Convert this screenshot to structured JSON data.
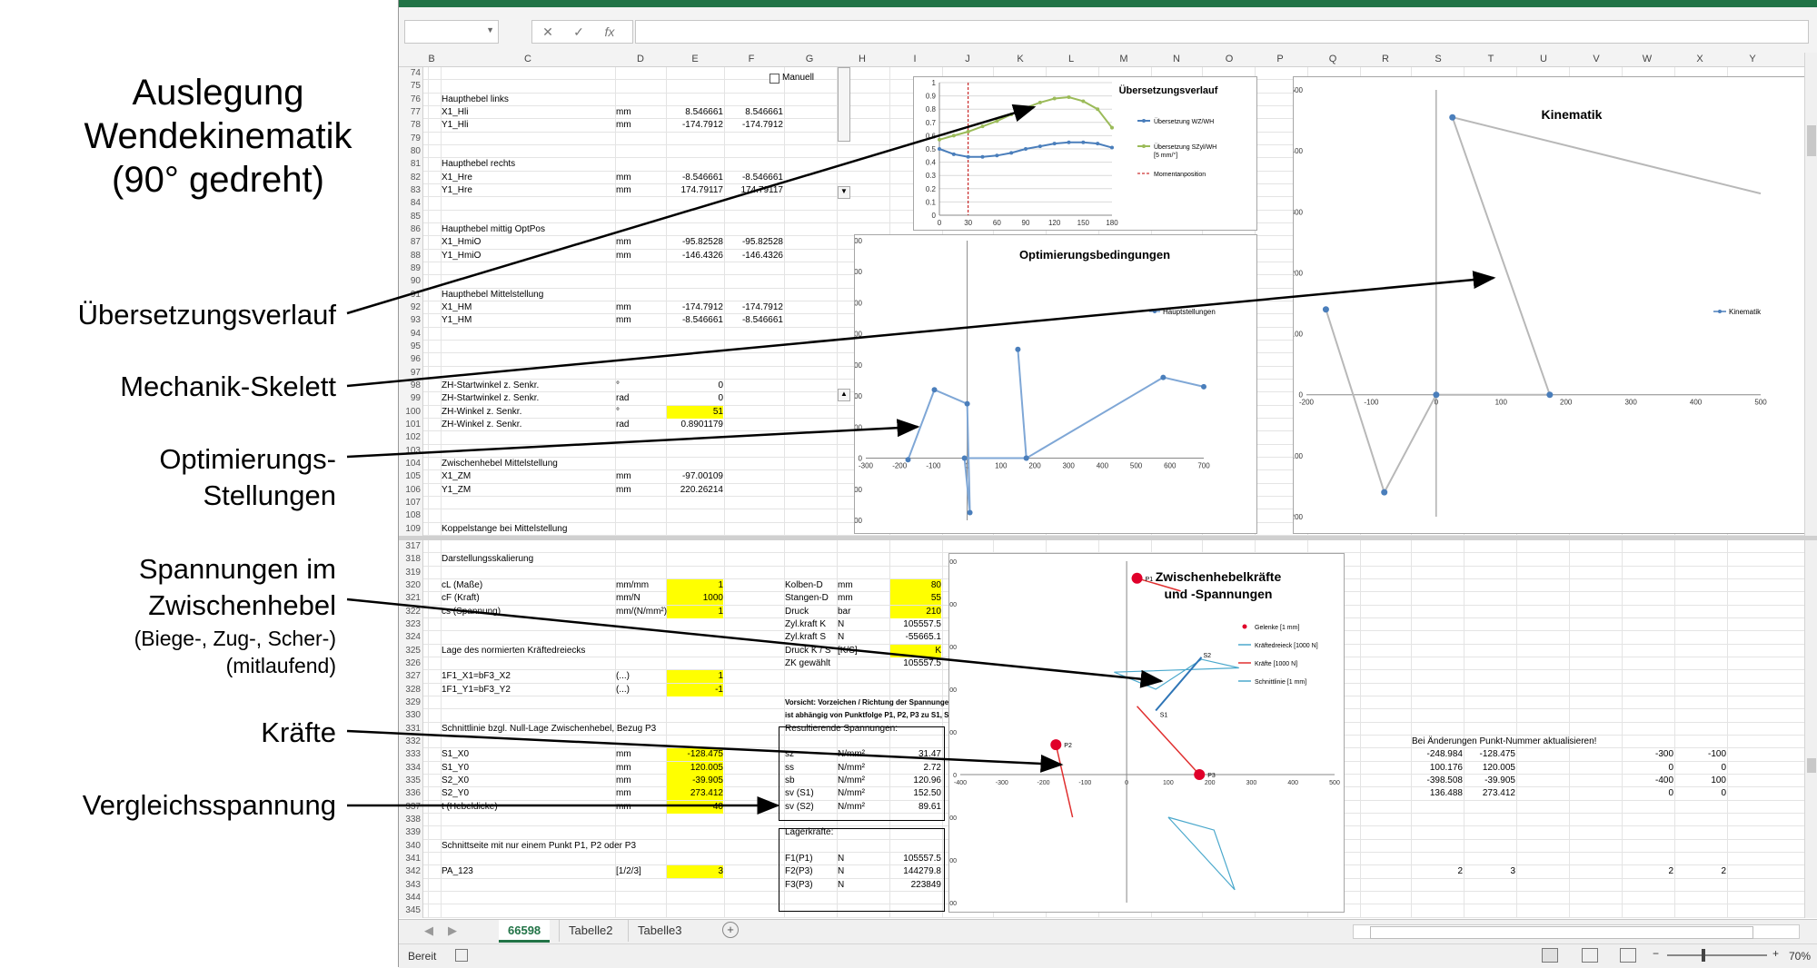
{
  "annotations": {
    "title": [
      "Auslegung",
      "Wendekinematik",
      "(90° gedreht)"
    ],
    "uebersetzungsverlauf": "Übersetzungsverlauf",
    "mechanik": "Mechanik-Skelett",
    "optimierung": [
      "Optimierungs-",
      "Stellungen"
    ],
    "spannungen": [
      "Spannungen im",
      "Zwischenhebel"
    ],
    "spannungen_sub": [
      "(Biege-, Zug-, Scher-)",
      "(mitlaufend)"
    ],
    "kraefte": "Kräfte",
    "vergleich": "Vergleichsspannung"
  },
  "formula_bar": {
    "fx": "fx",
    "cancel": "✕",
    "enter": "✓"
  },
  "columns": [
    "B",
    "C",
    "D",
    "E",
    "F",
    "G",
    "H",
    "I",
    "J",
    "K",
    "L",
    "M",
    "N",
    "O",
    "P",
    "Q",
    "R",
    "S",
    "T",
    "U",
    "V",
    "W",
    "X",
    "Y"
  ],
  "top_rows": [
    "74",
    "75",
    "76",
    "77",
    "78",
    "79",
    "80",
    "81",
    "82",
    "83",
    "84",
    "85",
    "86",
    "87",
    "88",
    "89",
    "90",
    "91",
    "92",
    "93",
    "94",
    "95",
    "96",
    "97",
    "98",
    "99",
    "100",
    "101",
    "102",
    "103",
    "104",
    "105",
    "106",
    "107",
    "108",
    "109"
  ],
  "bottom_rows": [
    "317",
    "318",
    "319",
    "320",
    "321",
    "322",
    "323",
    "324",
    "325",
    "326",
    "327",
    "328",
    "329",
    "330",
    "331",
    "332",
    "333",
    "334",
    "335",
    "336",
    "337",
    "338",
    "339",
    "340",
    "341",
    "342",
    "343",
    "344",
    "345"
  ],
  "top_cells": {
    "r76": {
      "c": "Haupthebel links"
    },
    "r77": {
      "c": "X1_Hli",
      "d": "mm",
      "e": "8.546661",
      "f": "8.546661"
    },
    "r78": {
      "c": "Y1_Hli",
      "d": "mm",
      "e": "-174.7912",
      "f": "-174.7912"
    },
    "r81": {
      "c": "Haupthebel rechts"
    },
    "r82": {
      "c": "X1_Hre",
      "d": "mm",
      "e": "-8.546661",
      "f": "-8.546661"
    },
    "r83": {
      "c": "Y1_Hre",
      "d": "mm",
      "e": "174.79117",
      "f": "174.79117"
    },
    "r86": {
      "c": "Haupthebel mittig OptPos"
    },
    "r87": {
      "c": "X1_HmiO",
      "d": "mm",
      "e": "-95.82528",
      "f": "-95.82528"
    },
    "r88": {
      "c": "Y1_HmiO",
      "d": "mm",
      "e": "-146.4326",
      "f": "-146.4326"
    },
    "r91": {
      "c": "Haupthebel Mittelstellung"
    },
    "r92": {
      "c": "X1_HM",
      "d": "mm",
      "e": "-174.7912",
      "f": "-174.7912"
    },
    "r93": {
      "c": "Y1_HM",
      "d": "mm",
      "e": "-8.546661",
      "f": "-8.546661"
    },
    "r98": {
      "c": "ZH-Startwinkel z. Senkr.",
      "d": "°",
      "e": "0"
    },
    "r99": {
      "c": "ZH-Startwinkel z. Senkr.",
      "d": "rad",
      "e": "0"
    },
    "r100": {
      "c": "ZH-Winkel z. Senkr.",
      "d": "°",
      "e": "51"
    },
    "r101": {
      "c": "ZH-Winkel z. Senkr.",
      "d": "rad",
      "e": "0.8901179"
    },
    "r104": {
      "c": "Zwischenhebel Mittelstellung"
    },
    "r105": {
      "c": "X1_ZM",
      "d": "mm",
      "e": "-97.00109"
    },
    "r106": {
      "c": "Y1_ZM",
      "d": "mm",
      "e": "220.26214"
    },
    "r109": {
      "c": "Koppelstange bei Mittelstellung"
    }
  },
  "bottom_cells": {
    "r318": {
      "c": "Darstellungsskalierung"
    },
    "r320": {
      "c": "cL (Maße)",
      "d": "mm/mm",
      "e": "1",
      "g": "Kolben-D",
      "h": "mm",
      "i": "80"
    },
    "r321": {
      "c": "cF (Kraft)",
      "d": "mm/N",
      "e": "1000",
      "g": "Stangen-D",
      "h": "mm",
      "i": "55"
    },
    "r322": {
      "c": "cs (Spannung)",
      "d": "mm/(N/mm²)",
      "e": "1",
      "g": "Druck",
      "h": "bar",
      "i": "210"
    },
    "r323": {
      "g": "Zyl.kraft K",
      "h": "N",
      "i": "105557.5"
    },
    "r324": {
      "g": "Zyl.kraft S",
      "h": "N",
      "i": "-55665.1"
    },
    "r325": {
      "c": "Lage des normierten Kräftedreiecks",
      "g": "Druck K / S",
      "h": "[K/S]",
      "i": "K"
    },
    "r326": {
      "g": "ZK gewählt",
      "i": "105557.5"
    },
    "r327": {
      "c": "1F1_X1=bF3_X2",
      "d": "(...)",
      "e": "1"
    },
    "r328": {
      "c": "1F1_Y1=bF3_Y2",
      "d": "(...)",
      "e": "-1"
    },
    "r329": {
      "g": "Vorsicht: Vorzeichen / Richtung der Spannungen"
    },
    "r330": {
      "g": "ist abhängig von Punktfolge P1, P2, P3 zu S1, S2!"
    },
    "r331": {
      "c": "Schnittlinie bzgl. Null-Lage Zwischenhebel, Bezug P3",
      "g": "Resultierende Spannungen:"
    },
    "r332": {
      "s": "Bei Änderungen Punkt-Nummer aktualisieren!"
    },
    "r333": {
      "c": "S1_X0",
      "d": "mm",
      "e": "-128.475",
      "g": "sz",
      "h": "N/mm²",
      "i": "31.47",
      "s": "-248.984",
      "t": "-128.475",
      "w": "-300",
      "x": "-100"
    },
    "r334": {
      "c": "S1_Y0",
      "d": "mm",
      "e": "120.005",
      "g": "ss",
      "h": "N/mm²",
      "i": "2.72",
      "s": "100.176",
      "t": "120.005",
      "w": "0",
      "x": "0"
    },
    "r335": {
      "c": "S2_X0",
      "d": "mm",
      "e": "-39.905",
      "g": "sb",
      "h": "N/mm²",
      "i": "120.96",
      "s": "-398.508",
      "t": "-39.905",
      "w": "-400",
      "x": "100"
    },
    "r336": {
      "c": "S2_Y0",
      "d": "mm",
      "e": "273.412",
      "g": "sv (S1)",
      "h": "N/mm²",
      "i": "152.50",
      "s": "136.488",
      "t": "273.412",
      "w": "0",
      "x": "0"
    },
    "r337": {
      "c": "t (Hebeldicke)",
      "d": "mm",
      "e": "40",
      "g": "sv (S2)",
      "h": "N/mm²",
      "i": "89.61"
    },
    "r339": {
      "g": "Lagerkräfte:"
    },
    "r340": {
      "c": "Schnittseite mit nur einem Punkt P1, P2 oder P3"
    },
    "r341": {
      "g": "F1(P1)",
      "h": "N",
      "i": "105557.5"
    },
    "r342": {
      "c": "PA_123",
      "d": "[1/2/3]",
      "e": "3",
      "g": "F2(P3)",
      "h": "N",
      "i": "144279.8",
      "s": "2",
      "t": "3",
      "w": "2",
      "x": "2"
    },
    "r343": {
      "g": "F3(P3)",
      "h": "N",
      "i": "223849"
    }
  },
  "charts": {
    "uebersetzung": {
      "title": "Übersetzungsverlauf",
      "type": "line",
      "x_ticks": [
        "0",
        "30",
        "60",
        "90",
        "120",
        "150",
        "180"
      ],
      "y_ticks": [
        "0",
        "0.1",
        "0.2",
        "0.3",
        "0.4",
        "0.5",
        "0.6",
        "0.7",
        "0.8",
        "0.9",
        "1"
      ],
      "xlim": [
        0,
        180
      ],
      "ylim": [
        0,
        1
      ],
      "legend": [
        "Übersetzung WZ/WH",
        "Übersetzung SZyl/WH",
        "[5 mm/°]",
        "Momentanposition"
      ],
      "series": [
        {
          "x": [
            0,
            15,
            30,
            45,
            60,
            75,
            90,
            105,
            120,
            135,
            150,
            165,
            180
          ],
          "y": [
            0.5,
            0.46,
            0.44,
            0.44,
            0.45,
            0.47,
            0.5,
            0.52,
            0.54,
            0.55,
            0.55,
            0.54,
            0.51
          ],
          "color": "#4a7ebb"
        },
        {
          "x": [
            0,
            15,
            30,
            45,
            60,
            75,
            90,
            105,
            120,
            135,
            150,
            165,
            180
          ],
          "y": [
            0.57,
            0.6,
            0.63,
            0.67,
            0.71,
            0.76,
            0.81,
            0.85,
            0.88,
            0.89,
            0.86,
            0.8,
            0.66
          ],
          "color": "#9bbb59"
        }
      ],
      "momentanposition_x": 30
    },
    "optimierung": {
      "title": "Optimierungsbedingungen",
      "type": "scatter",
      "x_ticks": [
        "-300",
        "-200",
        "-100",
        "0",
        "100",
        "200",
        "300",
        "400",
        "500",
        "600",
        "700"
      ],
      "y_ticks": [
        "-200",
        "-100",
        "0",
        "100",
        "200",
        "300",
        "400",
        "500",
        "600",
        "700"
      ],
      "xlim": [
        -300,
        700
      ],
      "ylim": [
        -200,
        700
      ],
      "legend": "Hauptstellungen",
      "points": [
        [
          -175,
          -5
        ],
        [
          -97,
          220
        ],
        [
          0,
          175
        ],
        [
          8,
          -175
        ],
        [
          -8,
          0
        ],
        [
          175,
          0
        ],
        [
          150,
          350
        ],
        [
          175,
          0
        ],
        [
          580,
          260
        ],
        [
          700,
          230
        ]
      ]
    },
    "kinematik": {
      "title": "Kinematik",
      "type": "scatter",
      "x_ticks": [
        "-200",
        "-100",
        "0",
        "100",
        "200",
        "300",
        "400",
        "500"
      ],
      "y_ticks": [
        "-200",
        "-100",
        "0",
        "100",
        "200",
        "300",
        "400",
        "500"
      ],
      "xlim": [
        -200,
        500
      ],
      "ylim": [
        -200,
        500
      ],
      "legend": "Kinematik",
      "points": [
        [
          -170,
          140
        ],
        [
          -80,
          -160
        ],
        [
          0,
          0
        ],
        [
          175,
          0
        ],
        [
          25,
          455
        ],
        [
          500,
          330
        ]
      ]
    },
    "zwischenhebel": {
      "title": [
        "Zwischenhebelkräfte",
        "und -Spannungen"
      ],
      "type": "scatter",
      "x_ticks": [
        "-400",
        "-300",
        "-200",
        "-100",
        "0",
        "100",
        "200",
        "300",
        "400",
        "500"
      ],
      "y_ticks": [
        "-300",
        "-200",
        "-100",
        "0",
        "100",
        "200",
        "300",
        "400",
        "500"
      ],
      "xlim": [
        -400,
        500
      ],
      "ylim": [
        -300,
        500
      ],
      "legend": [
        "Gelenke [1 mm]",
        "Kräftedreieck [1000 N]",
        "Kräfte [1000 N]",
        "Schnittlinie [1 mm]"
      ],
      "joints": [
        {
          "label": "P1",
          "x": 25,
          "y": 460
        },
        {
          "label": "P2",
          "x": -170,
          "y": 70
        },
        {
          "label": "P3",
          "x": 175,
          "y": 0
        }
      ],
      "point_labels": [
        "S1",
        "S2"
      ]
    }
  },
  "checkbox_label": "Manuell",
  "sheet_tabs": [
    "66598",
    "Tabelle2",
    "Tabelle3"
  ],
  "status": {
    "ready": "Bereit",
    "zoom": "70%"
  }
}
